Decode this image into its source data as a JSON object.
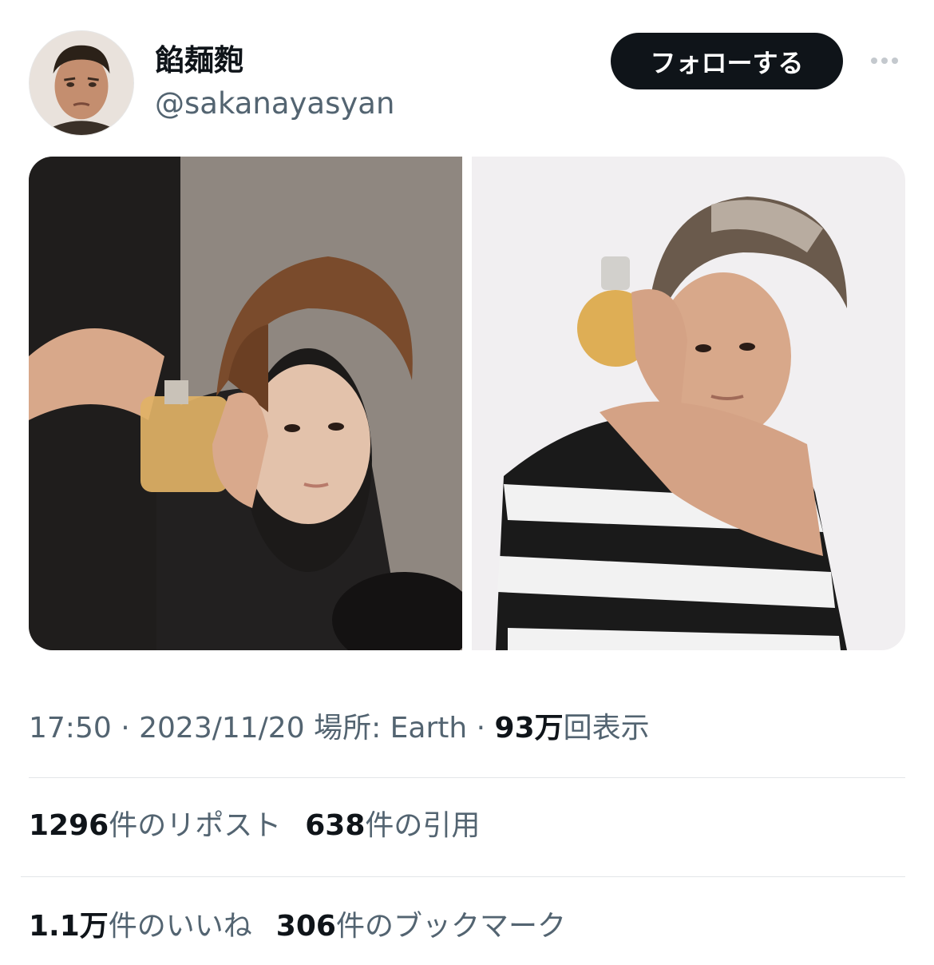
{
  "author": {
    "display_name": "餡麺麭",
    "handle": "@sakanayasyan",
    "avatar_icon": "profile-photo-icon"
  },
  "actions": {
    "follow_label": "フォローする",
    "more_icon": "more-dots-icon"
  },
  "media": {
    "photos": [
      "photo-left",
      "photo-right"
    ]
  },
  "meta": {
    "time": "17:50",
    "separator": "·",
    "date": "2023/11/20",
    "location_label": "場所: Earth",
    "views_value": "93万",
    "views_label": "回表示"
  },
  "stats": {
    "reposts_value": "1296",
    "reposts_label": "件のリポスト",
    "quotes_value": "638",
    "quotes_label": "件の引用",
    "likes_value": "1.1万",
    "likes_label": "件のいいね",
    "bookmarks_value": "306",
    "bookmarks_label": "件のブックマーク"
  },
  "colors": {
    "text_primary": "#0f1419",
    "text_secondary": "#536471",
    "button_bg": "#0f1419",
    "divider": "#e3e6e8"
  }
}
